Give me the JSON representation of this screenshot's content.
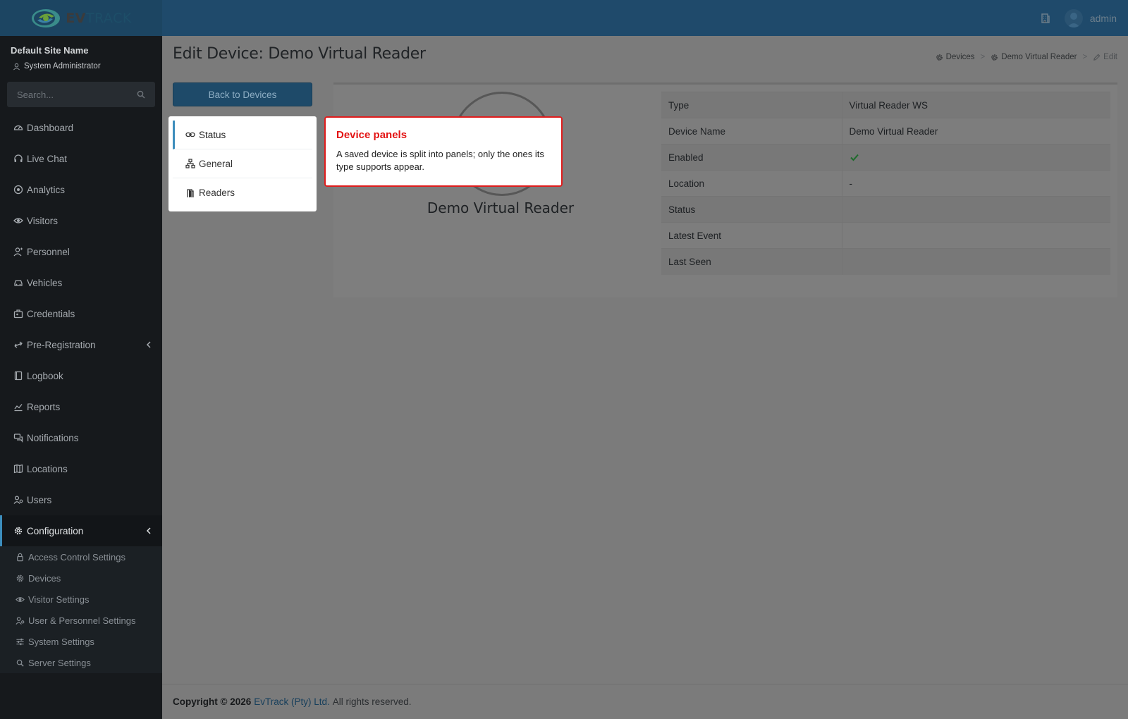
{
  "brand": {
    "logo_prefix": "EV",
    "logo_suffix": "TRACK"
  },
  "header": {
    "username": "admin"
  },
  "sidebar": {
    "site_name": "Default Site Name",
    "role": "System Administrator",
    "search_placeholder": "Search...",
    "items": [
      {
        "label": "Dashboard",
        "icon": "dashboard-icon"
      },
      {
        "label": "Live Chat",
        "icon": "headset-icon"
      },
      {
        "label": "Analytics",
        "icon": "target-icon"
      },
      {
        "label": "Visitors",
        "icon": "eye-icon"
      },
      {
        "label": "Personnel",
        "icon": "person-icon"
      },
      {
        "label": "Vehicles",
        "icon": "car-icon"
      },
      {
        "label": "Credentials",
        "icon": "credential-icon"
      },
      {
        "label": "Pre-Registration",
        "icon": "arrows-icon"
      },
      {
        "label": "Logbook",
        "icon": "book-icon"
      },
      {
        "label": "Reports",
        "icon": "chart-icon"
      },
      {
        "label": "Notifications",
        "icon": "chat-icon"
      },
      {
        "label": "Locations",
        "icon": "map-icon"
      },
      {
        "label": "Users",
        "icon": "users-icon"
      },
      {
        "label": "Configuration",
        "icon": "gear-icon"
      }
    ],
    "config_submenu": [
      {
        "label": "Access Control Settings",
        "icon": "lock-icon"
      },
      {
        "label": "Devices",
        "icon": "gear-icon"
      },
      {
        "label": "Visitor Settings",
        "icon": "eye-icon"
      },
      {
        "label": "User & Personnel Settings",
        "icon": "users-icon"
      },
      {
        "label": "System Settings",
        "icon": "sliders-icon"
      },
      {
        "label": "Server Settings",
        "icon": "server-icon"
      }
    ]
  },
  "page": {
    "title": "Edit Device: Demo Virtual Reader",
    "breadcrumb": [
      "Devices",
      "Demo Virtual Reader",
      "Edit"
    ],
    "back_button": "Back to Devices",
    "tabs": [
      "Status",
      "General",
      "Readers"
    ],
    "device_name": "Demo Virtual Reader"
  },
  "status_table": [
    {
      "key": "Type",
      "value": "Virtual Reader WS"
    },
    {
      "key": "Device Name",
      "value": "Demo Virtual Reader"
    },
    {
      "key": "Enabled",
      "value": ""
    },
    {
      "key": "Location",
      "value": "-"
    },
    {
      "key": "Status",
      "value": ""
    },
    {
      "key": "Latest Event",
      "value": ""
    },
    {
      "key": "Last Seen",
      "value": ""
    }
  ],
  "callout": {
    "title": "Device panels",
    "body": "A saved device is split into panels; only the ones its type supports appear."
  },
  "footer": {
    "copyright": "Copyright © 2026",
    "company": "EvTrack (Pty) Ltd.",
    "rights": "All rights reserved."
  },
  "colors": {
    "header": "#1f4a6b",
    "sidebar": "#16191c",
    "accent": "#3c8dbc",
    "callout_border": "#e01c1c"
  }
}
